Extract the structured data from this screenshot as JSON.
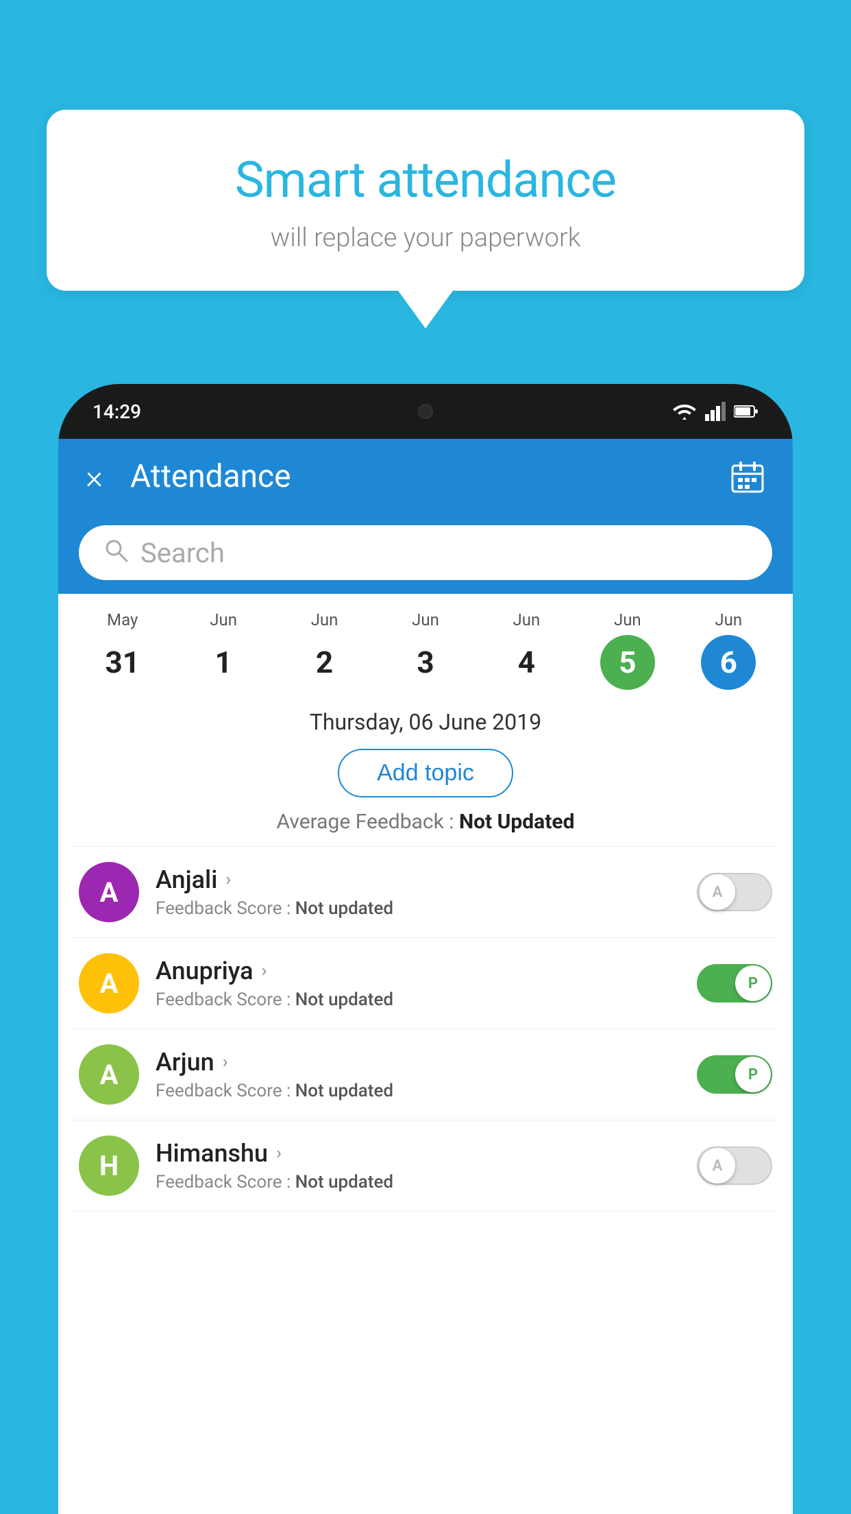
{
  "background_color": "#29B6E0",
  "speech_bubble": {
    "title": "Smart attendance",
    "subtitle": "will replace your paperwork"
  },
  "status_bar": {
    "time": "14:29"
  },
  "header": {
    "title": "Attendance",
    "close_label": "×"
  },
  "search": {
    "placeholder": "Search"
  },
  "calendar": {
    "days": [
      {
        "month": "May",
        "num": "31",
        "state": "normal"
      },
      {
        "month": "Jun",
        "num": "1",
        "state": "normal"
      },
      {
        "month": "Jun",
        "num": "2",
        "state": "normal"
      },
      {
        "month": "Jun",
        "num": "3",
        "state": "normal"
      },
      {
        "month": "Jun",
        "num": "4",
        "state": "normal"
      },
      {
        "month": "Jun",
        "num": "5",
        "state": "today"
      },
      {
        "month": "Jun",
        "num": "6",
        "state": "selected"
      }
    ],
    "selected_date": "Thursday, 06 June 2019"
  },
  "add_topic_label": "Add topic",
  "average_feedback": {
    "label": "Average Feedback : ",
    "value": "Not Updated"
  },
  "students": [
    {
      "name": "Anjali",
      "avatar_letter": "A",
      "avatar_color": "#9C27B0",
      "feedback_label": "Feedback Score : ",
      "feedback_value": "Not updated",
      "toggle": "off",
      "toggle_letter": "A"
    },
    {
      "name": "Anupriya",
      "avatar_letter": "A",
      "avatar_color": "#FFC107",
      "feedback_label": "Feedback Score : ",
      "feedback_value": "Not updated",
      "toggle": "on",
      "toggle_letter": "P"
    },
    {
      "name": "Arjun",
      "avatar_letter": "A",
      "avatar_color": "#8BC34A",
      "feedback_label": "Feedback Score : ",
      "feedback_value": "Not updated",
      "toggle": "on",
      "toggle_letter": "P"
    },
    {
      "name": "Himanshu",
      "avatar_letter": "H",
      "avatar_color": "#8BC34A",
      "feedback_label": "Feedback Score : ",
      "feedback_value": "Not updated",
      "toggle": "off",
      "toggle_letter": "A"
    }
  ]
}
